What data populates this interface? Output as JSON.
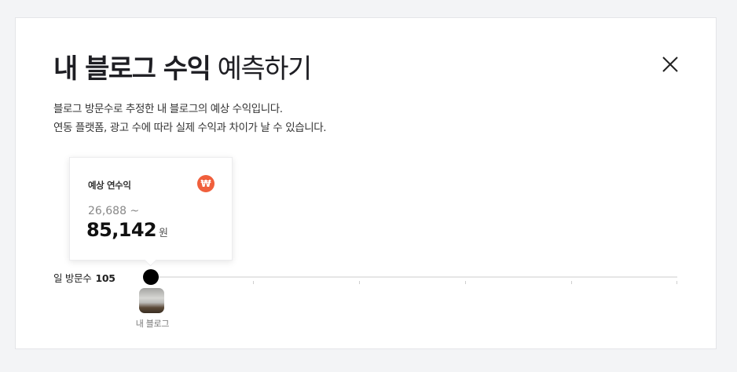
{
  "modal": {
    "title_bold": "내 블로그 수익",
    "title_light": " 예측하기",
    "description": [
      "블로그 방문수로 추정한 내 블로그의 예상 수익입니다.",
      "연동 플랫폼, 광고 수에 따라 실제 수익과 차이가 날 수 있습니다."
    ],
    "close_icon": "close-icon"
  },
  "tooltip": {
    "label": "예상 연수익",
    "icon_symbol": "₩",
    "icon_color": "#f05f3c",
    "range_start": "26,688 ~",
    "value": "85,142",
    "unit": "원"
  },
  "slider": {
    "label": "일 방문수",
    "value": "105",
    "position_fraction": 0,
    "avatar_label": "내 블로그"
  }
}
